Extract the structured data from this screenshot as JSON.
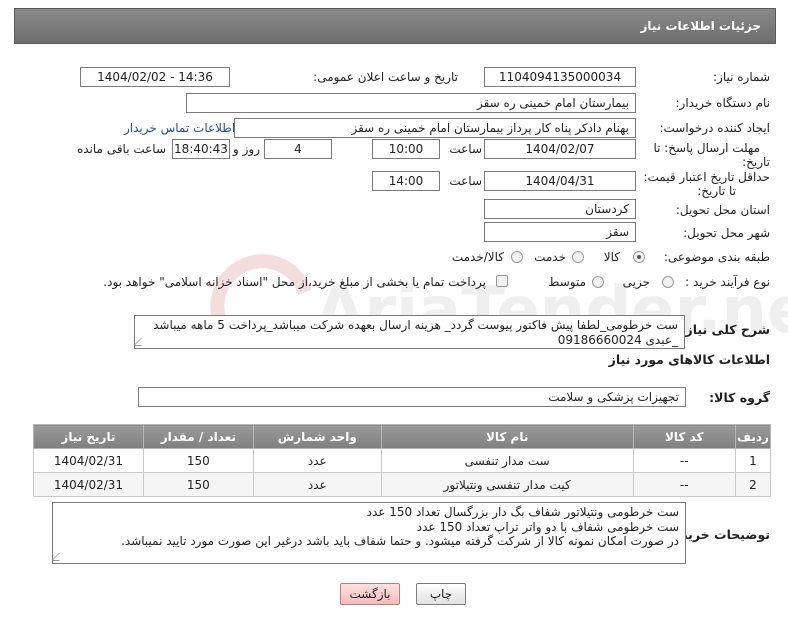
{
  "header": {
    "title": "جزئیات اطلاعات نیاز"
  },
  "form": {
    "need_number": {
      "label": "شماره نیاز:",
      "value": "1104094135000034"
    },
    "announce_datetime": {
      "label": "تاریخ و ساعت اعلان عمومی:",
      "value": "1404/02/02 - 14:36"
    },
    "buyer_org": {
      "label": "نام دستگاه خریدار:",
      "value": "بیمارستان امام خمینی  ره  سقز"
    },
    "requester": {
      "label": "ایجاد کننده درخواست:",
      "value": "بهنام دادکر پناه کار پرداز بیمارستان امام خمینی  ره  سقز",
      "contact_link": "اطلاعات تماس خریدار"
    },
    "response_deadline": {
      "label_line1": "مهلت ارسال پاسخ: تا",
      "label_line2": "تاریخ:",
      "date": "1404/02/07",
      "time_label": "ساعت",
      "time": "10:00",
      "days": "4",
      "days_label": "روز و",
      "remaining": "18:40:43",
      "remaining_label": "ساعت باقی مانده"
    },
    "price_validity": {
      "label_line1": "حداقل تاریخ اعتبار قیمت:",
      "label_line2": "تا تاریخ:",
      "date": "1404/04/31",
      "time_label": "ساعت",
      "time": "14:00"
    },
    "province": {
      "label": "استان محل تحویل:",
      "value": "کردستان"
    },
    "city": {
      "label": "شهر محل تحویل:",
      "value": "سقز"
    },
    "category": {
      "label": "طبقه بندی موضوعی:",
      "options": [
        "کالا",
        "خدمت",
        "کالا/خدمت"
      ],
      "selected": "کالا"
    },
    "purchase_type": {
      "label": "نوع فرآیند خرید :",
      "options": [
        "جزیی",
        "متوسط"
      ],
      "selected": "",
      "payment_note": "پرداخت تمام یا بخشی از مبلغ خرید،از محل \"اسناد خزانه اسلامی\" خواهد بود."
    }
  },
  "description": {
    "label": "شرح کلی نیاز:",
    "line1": "ست خرطومی_لطفا پیش فاکتور پیوست گردد_ هزینه ارسال بعهده شرکت میباشد_پرداخت 5 ماهه میباشد",
    "line2": "_عبدی 09186660024"
  },
  "items_section": {
    "title": "اطلاعات کالاهای مورد نیاز",
    "group_label": "گروه کالا:",
    "group_value": "تجهیزات پزشکی و سلامت",
    "columns": [
      "ردیف",
      "کد کالا",
      "نام کالا",
      "واحد شمارش",
      "تعداد / مقدار",
      "تاریخ نیاز"
    ],
    "rows": [
      {
        "index": "1",
        "code": "--",
        "name": "ست مدار تنفسی",
        "unit": "عدد",
        "qty": "150",
        "date": "1404/02/31"
      },
      {
        "index": "2",
        "code": "--",
        "name": "کیت مدار تنفسی ونتیلاتور",
        "unit": "عدد",
        "qty": "150",
        "date": "1404/02/31"
      }
    ]
  },
  "buyer_notes": {
    "label": "توضیحات خریدار:",
    "line1": "ست خرطومی ونتیلاتور  شفاف بگ دار  بزرگسال   تعداد 150 عدد",
    "line2": "ست خرطومی شفاف با دو واتر تراپ           تعداد  150  عدد",
    "line3": "در صورت امکان نمونه کالا  از شرکت گرفته میشود. و حتما شفاف  باید  باشد درغیر این صورت مورد تایید نمیباشد."
  },
  "buttons": {
    "print": "چاپ",
    "back": "بازگشت"
  },
  "watermark": {
    "text": "AriaTender.neT"
  }
}
